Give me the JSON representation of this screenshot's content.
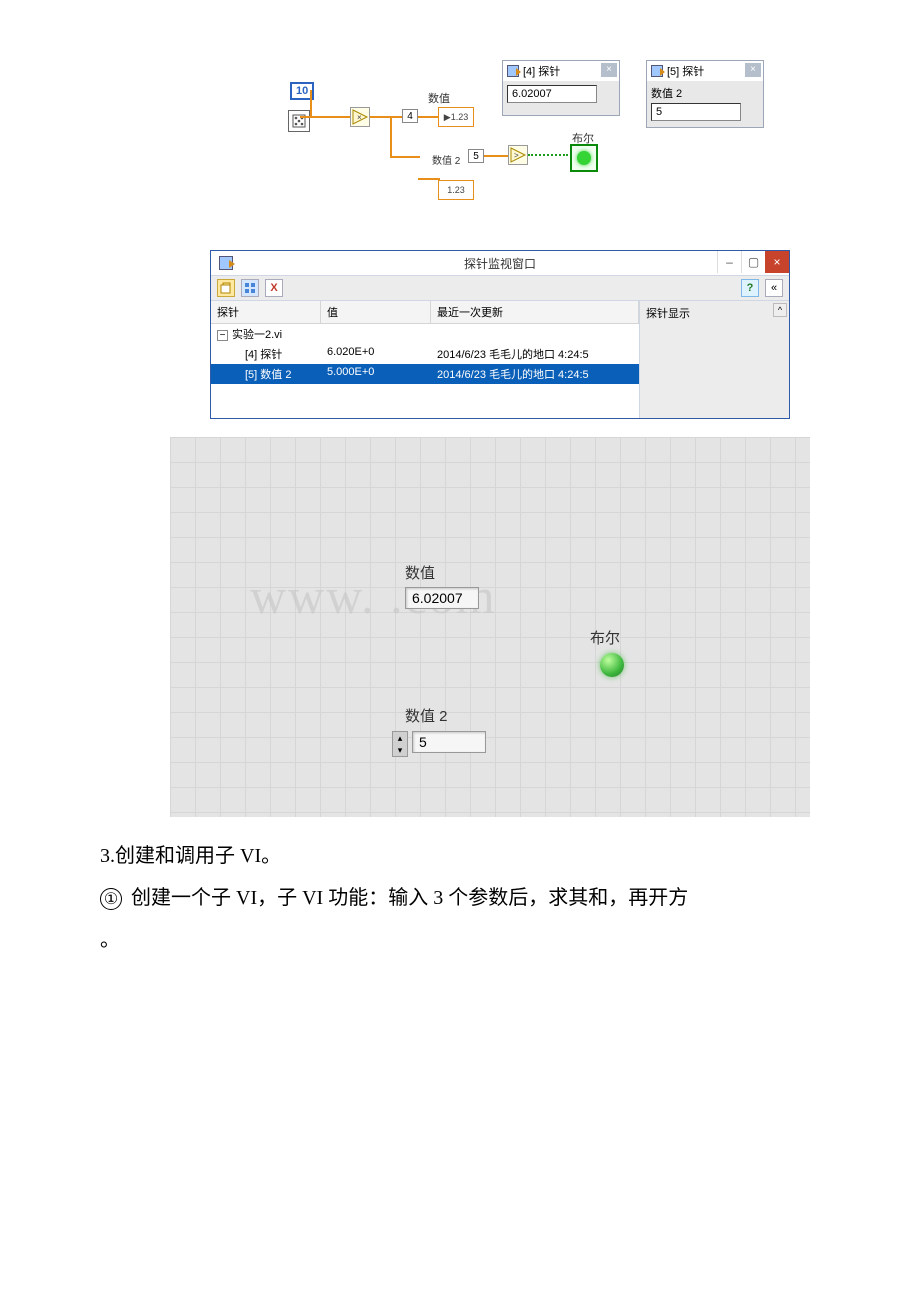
{
  "block_diagram": {
    "const_10": "10",
    "probe4_badge": "4",
    "probe5_badge": "5",
    "label_value": "数值",
    "label_value2": "数值 2",
    "label_bool": "布尔",
    "indicator_text": "1.23"
  },
  "probe_windows": {
    "probe4": {
      "title": "[4] 探针",
      "value": "6.02007"
    },
    "probe5": {
      "title": "[5] 探针",
      "field_label": "数值 2",
      "value": "5"
    }
  },
  "watch_window": {
    "title": "探针监视窗口",
    "right_label": "探针显示",
    "toolbar": {
      "help_icon": "?",
      "chevron_icon": "«",
      "x_icon": "X"
    },
    "headers": {
      "probe": "探针",
      "value": "值",
      "updated": "最近一次更新"
    },
    "rows": {
      "vi_name": "实验一2.vi",
      "row1": {
        "probe": "[4] 探针",
        "value": "6.020E+0",
        "updated": "2014/6/23 毛毛儿的地口 4:24:5"
      },
      "row2": {
        "probe": "[5] 数值 2",
        "value": "5.000E+0",
        "updated": "2014/6/23 毛毛儿的地口 4:24:5"
      }
    },
    "win_controls": {
      "min": "–",
      "max": "▢",
      "close": "×"
    }
  },
  "front_panel": {
    "watermark": "www.                 .com",
    "value_label": "数值",
    "value_field": "6.02007",
    "value2_label": "数值 2",
    "value2_field": "5",
    "bool_label": "布尔"
  },
  "body": {
    "line1": "3.创建和调用子 VI。",
    "line2_circled": "①",
    "line2": " 创建一个子 VI，子 VI 功能：输入 3 个参数后，求其和，再开方",
    "line3": "。"
  }
}
